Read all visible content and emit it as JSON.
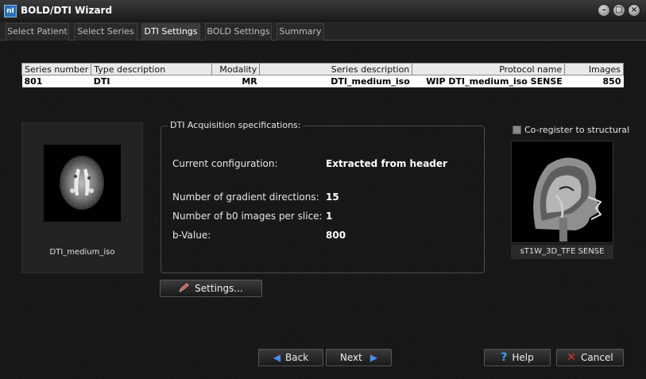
{
  "window": {
    "title": "BOLD/DTI Wizard",
    "app_icon_text": "nI"
  },
  "tabs": [
    "Select Patient",
    "Select Series",
    "DTI Settings",
    "BOLD Settings",
    "Summary"
  ],
  "series_table": {
    "headers": [
      "Series number",
      "Type description",
      "Modality",
      "Series description",
      "Protocol name",
      "Images"
    ],
    "row": [
      "801",
      "DTI",
      "MR",
      "DTI_medium_iso",
      "WIP DTI_medium_iso SENSE",
      "850"
    ]
  },
  "dti_thumbnail": {
    "caption": "DTI_medium_iso"
  },
  "spec": {
    "legend": "DTI Acquisition specifications:",
    "current_configuration_label": "Current configuration:",
    "current_configuration_value": "Extracted from header",
    "gradient_directions_label": "Number of gradient directions:",
    "gradient_directions_value": "15",
    "b0_images_label": "Number of b0 images per slice:",
    "b0_images_value": "1",
    "bvalue_label": "b-Value:",
    "bvalue_value": "800"
  },
  "settings_button": "Settings...",
  "coregister": {
    "label": "Co-register to structural",
    "checked": false
  },
  "structural_thumbnail": {
    "caption": "sT1W_3D_TFE SENSE"
  },
  "nav": {
    "back": "Back",
    "next": "Next"
  },
  "help_button": "Help",
  "cancel_button": "Cancel"
}
